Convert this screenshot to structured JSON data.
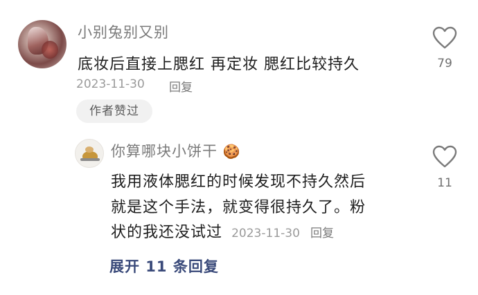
{
  "comment": {
    "username": "小别兔别又别",
    "text": "底妆后直接上腮红  再定妆 腮红比较持久",
    "date": "2023-11-30",
    "reply_label": "回复",
    "author_badge": "作者赞过",
    "like_count": "79",
    "like_icon": "heart-outline-icon"
  },
  "reply": {
    "username": "你算哪块小饼干",
    "user_emoji": "🍪",
    "text_line1": "我用液体腮红的时候发现不持久然后",
    "text_line2": "就是这个手法，就变得很持久了。粉",
    "text_line3": "状的我还没试过",
    "date": "2023-11-30",
    "reply_label": "回复",
    "like_count": "11",
    "like_icon": "heart-outline-icon"
  },
  "expand_replies": "展开 11 条回复",
  "colors": {
    "text_primary": "#1e1e1e",
    "text_secondary": "#7a7a7a",
    "expand_link": "#3a4a7a",
    "badge_bg": "#f1f1f1"
  }
}
